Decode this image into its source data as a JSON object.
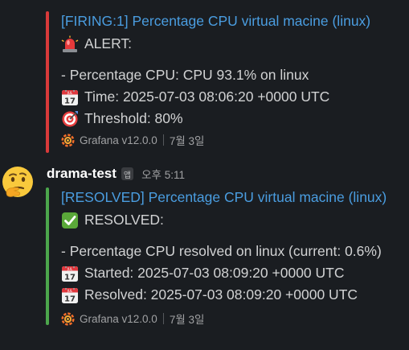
{
  "colors": {
    "background": "#1a1d21",
    "link": "#4a9de0",
    "firing_bar": "#d93a3a",
    "resolved_bar": "#4ca64c"
  },
  "message1": {
    "title": "[FIRING:1] Percentage CPU virtual macine (linux)",
    "heading": "ALERT:",
    "heading_icon": "rotating-light-icon",
    "detail": "- Percentage CPU: CPU 93.1% on linux",
    "time_line": "Time: 2025-07-03 08:06:20 +0000 UTC",
    "time_icon": "calendar-icon",
    "threshold_line": "Threshold: 80%",
    "threshold_icon": "direct-hit-icon",
    "footer_source": "Grafana v12.0.0",
    "footer_date": "7월 3일"
  },
  "message2": {
    "author": "drama-test",
    "app_badge": "앱",
    "timestamp": "오후 5:11",
    "title": "[RESOLVED] Percentage CPU virtual macine (linux)",
    "heading": "RESOLVED:",
    "heading_icon": "check-mark-button-icon",
    "detail": "- Percentage CPU resolved on linux (current: 0.6%)",
    "started_line": "Started: 2025-07-03 08:09:20 +0000 UTC",
    "resolved_line": "Resolved: 2025-07-03 08:09:20 +0000 UTC",
    "footer_source": "Grafana v12.0.0",
    "footer_date": "7월 3일"
  }
}
